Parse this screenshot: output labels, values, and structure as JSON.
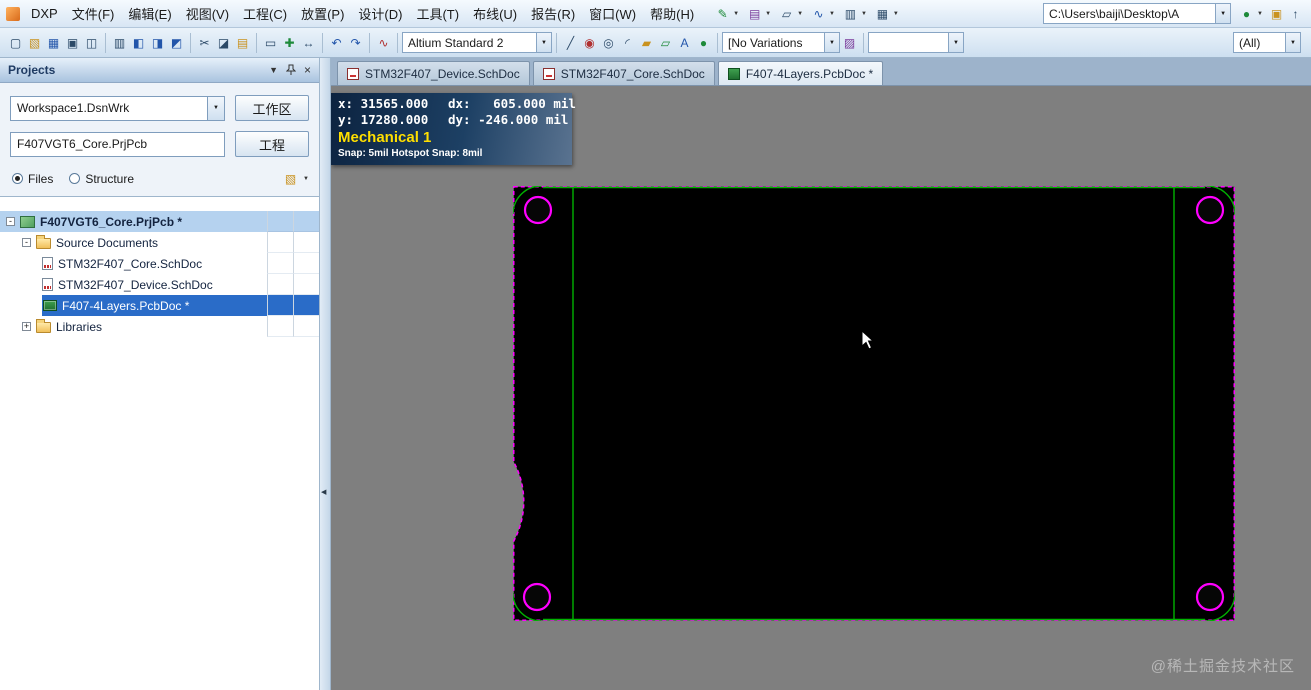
{
  "colors": {
    "selection": "#2a6cc8",
    "row_highlight": "#b5d2ef",
    "board_outline": "#ff00ff",
    "board_silk": "#00b200",
    "hud_layer": "#ffdf00",
    "canvas_bg": "#7f7f7f",
    "board_bg": "#000000"
  },
  "ui_icons": {
    "chevron_down": "▼",
    "close": "×",
    "collapse_left": "◀"
  },
  "menubar": {
    "menus": [
      "DXP",
      "文件(F)",
      "编辑(E)",
      "视图(V)",
      "工程(C)",
      "放置(P)",
      "设计(D)",
      "工具(T)",
      "布线(U)",
      "报告(R)",
      "窗口(W)",
      "帮助(H)"
    ],
    "tools": {
      "cross_probe": "✎",
      "layer_sets": "▤",
      "footprints": "▱",
      "signals": "∿",
      "board_insight": "▥",
      "grid": "▦",
      "web_update": "●",
      "install": "▣",
      "up_level": "↑"
    },
    "path_combo": "C:\\Users\\baiji\\Desktop\\A"
  },
  "toolbar": {
    "icons": {
      "new": "▢",
      "open": "▧",
      "save": "▦",
      "print": "▣",
      "print_preview": "◫",
      "panels": "▥",
      "zoom_window": "◧",
      "zoom_fit": "◨",
      "zoom_selected": "◩",
      "cut": "✂",
      "copy": "◪",
      "paste": "▤",
      "select_area": "▭",
      "move": "✚",
      "offset": "↔",
      "undo": "↶",
      "redo": "↷",
      "wire": "∿",
      "line": "╱",
      "pad": "◉",
      "via": "◎",
      "arc": "◜",
      "fill": "▰",
      "polygon": "▱",
      "string": "A",
      "drc": "●",
      "camera": "▨"
    },
    "style_combo": "Altium Standard 2",
    "variant_combo": "[No Variations",
    "empty_combo": "",
    "filter_combo": "(All)"
  },
  "tabs": [
    {
      "label": "STM32F407_Device.SchDoc"
    },
    {
      "label": "STM32F407_Core.SchDoc"
    },
    {
      "label": "F407-4Layers.PcbDoc *"
    }
  ],
  "projects_panel": {
    "title": "Projects",
    "workspace_combo": "Workspace1.DsnWrk",
    "workspace_button": "工作区",
    "project_field": "F407VGT6_Core.PrjPcb",
    "project_button": "工程",
    "radios": {
      "files": "Files",
      "structure": "Structure"
    },
    "tree": [
      {
        "label": "F407VGT6_Core.PrjPcb *",
        "expander": "-"
      },
      {
        "label": "Source Documents",
        "expander": "-"
      },
      {
        "label": "STM32F407_Core.SchDoc"
      },
      {
        "label": "STM32F407_Device.SchDoc"
      },
      {
        "label": "F407-4Layers.PcbDoc *"
      },
      {
        "label": "Libraries",
        "expander": "+"
      }
    ]
  },
  "hud": {
    "line1_left": "x: 31565.000",
    "line1_right": "dx:   605.000 mil",
    "line2_left": "y: 17280.000",
    "line2_right": "dy: -246.000 mil",
    "layer": "Mechanical 1",
    "snap": "Snap: 5mil Hotspot Snap: 8mil"
  },
  "watermark": "@稀土掘金技术社区"
}
